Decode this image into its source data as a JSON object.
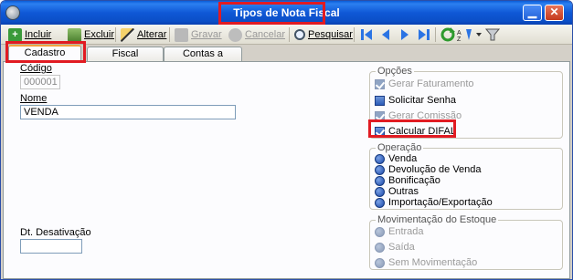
{
  "window": {
    "title": "Tipos de Nota Fiscal",
    "minimize_glyph": "▁",
    "close_glyph": "✕"
  },
  "toolbar": {
    "incluir": "Incluir",
    "excluir": "Excluir",
    "alterar": "Alterar",
    "gravar": "Gravar",
    "cancelar": "Cancelar",
    "pesquisar": "Pesquisar"
  },
  "tabs": [
    "Cadastro",
    "Fiscal",
    "Contas a Receber"
  ],
  "form": {
    "codigo_label": "Código",
    "codigo_value": "000001",
    "nome_label": "Nome",
    "nome_value": "VENDA",
    "dt_desativacao_label": "Dt. Desativação",
    "dt_desativacao_value": ""
  },
  "opcoes": {
    "title": "Opções",
    "items": [
      {
        "label": "Gerar Faturamento",
        "checked": true,
        "enabled": false
      },
      {
        "label": "Solicitar Senha",
        "checked": false,
        "enabled": true
      },
      {
        "label": "Gerar Comissão",
        "checked": true,
        "enabled": false
      },
      {
        "label": "Calcular DIFAL",
        "checked": true,
        "enabled": true
      }
    ]
  },
  "operacao": {
    "title": "Operação",
    "items": [
      "Venda",
      "Devolução de Venda",
      "Bonificação",
      "Outras",
      "Importação/Exportação"
    ]
  },
  "movimentacao": {
    "title": "Movimentação do Estoque",
    "items": [
      "Entrada",
      "Saída",
      "Sem Movimentação"
    ]
  },
  "colors": {
    "title_blue": "#0b4fc7",
    "highlight_red": "#e11b22",
    "tab_accent": "#f1a33d"
  }
}
